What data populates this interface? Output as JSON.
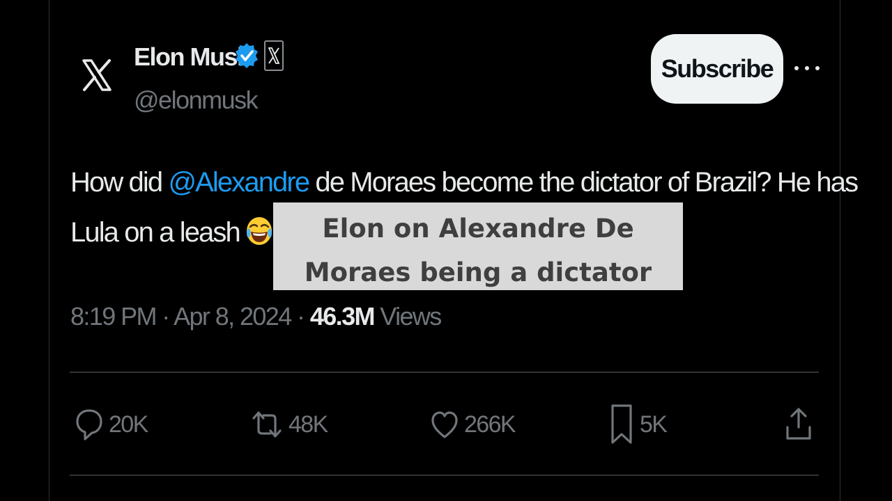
{
  "author": {
    "display_name": "Elon Musk",
    "handle": "@elonmusk",
    "avatar_icon": "x-logo-icon",
    "verified_icon": "verified-badge-icon",
    "affiliate_icon": "x-affiliate-badge-icon"
  },
  "header": {
    "subscribe_label": "Subscribe",
    "more_icon": "more-icon"
  },
  "tweet": {
    "line1_before": "How did ",
    "mention": "@Alexandre",
    "line1_after": " de Moraes become the dictator of Brazil? He has",
    "line2": "Lula on a leash",
    "emoji_icon": "face-with-tears-of-joy-icon"
  },
  "caption": {
    "line1": "Elon on Alexandre De",
    "line2": "Moraes being a dictator"
  },
  "meta": {
    "time": "8:19 PM",
    "separator1": " · ",
    "date": "Apr 8, 2024",
    "separator2": " · ",
    "views_count": "46.3M",
    "views_label": " Views"
  },
  "actions": {
    "reply": {
      "icon": "reply-icon",
      "count": "20K"
    },
    "repost": {
      "icon": "repost-icon",
      "count": "48K"
    },
    "like": {
      "icon": "heart-icon",
      "count": "266K"
    },
    "bookmark": {
      "icon": "bookmark-icon",
      "count": "5K"
    },
    "share": {
      "icon": "share-icon"
    }
  },
  "colors": {
    "background": "#000000",
    "text_primary": "#e7e9ea",
    "text_secondary": "#71767b",
    "link": "#1d9bf0",
    "subscribe_bg": "#eff3f4",
    "caption_bg": "#d9d9d9",
    "border": "#2f3336"
  }
}
